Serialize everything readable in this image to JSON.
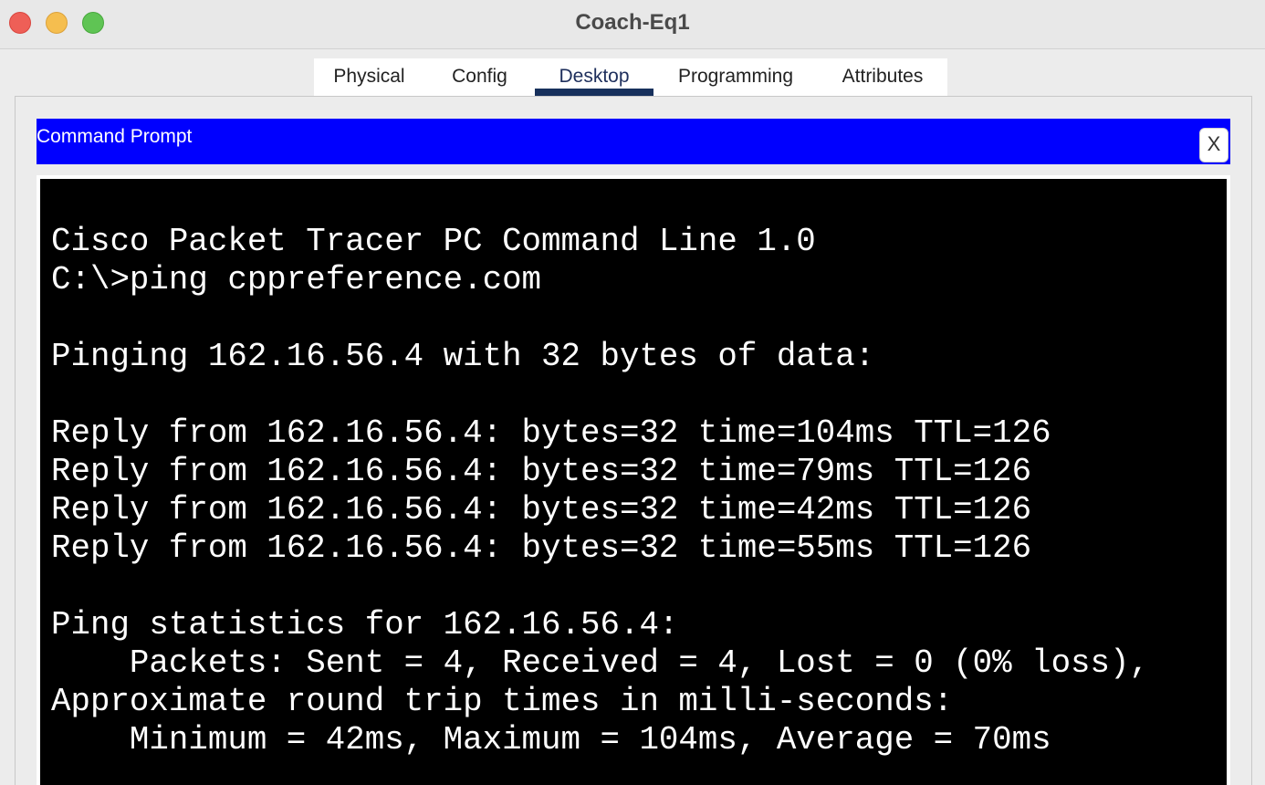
{
  "window": {
    "title": "Coach-Eq1"
  },
  "tabs": [
    {
      "label": "Physical"
    },
    {
      "label": "Config"
    },
    {
      "label": "Desktop"
    },
    {
      "label": "Programming"
    },
    {
      "label": "Attributes"
    }
  ],
  "active_tab": "Desktop",
  "app": {
    "title": "Command Prompt",
    "close_label": "X"
  },
  "terminal": {
    "lines": [
      "Cisco Packet Tracer PC Command Line 1.0",
      "C:\\>ping cppreference.com",
      "",
      "Pinging 162.16.56.4 with 32 bytes of data:",
      "",
      "Reply from 162.16.56.4: bytes=32 time=104ms TTL=126",
      "Reply from 162.16.56.4: bytes=32 time=79ms TTL=126",
      "Reply from 162.16.56.4: bytes=32 time=42ms TTL=126",
      "Reply from 162.16.56.4: bytes=32 time=55ms TTL=126",
      "",
      "Ping statistics for 162.16.56.4:",
      "    Packets: Sent = 4, Received = 4, Lost = 0 (0% loss),",
      "Approximate round trip times in milli-seconds:",
      "    Minimum = 42ms, Maximum = 104ms, Average = 70ms"
    ]
  },
  "colors": {
    "header_bar": "#0000ff",
    "terminal_bg": "#000000",
    "terminal_text": "#ffffff",
    "active_tab_indicator": "#17305c"
  }
}
